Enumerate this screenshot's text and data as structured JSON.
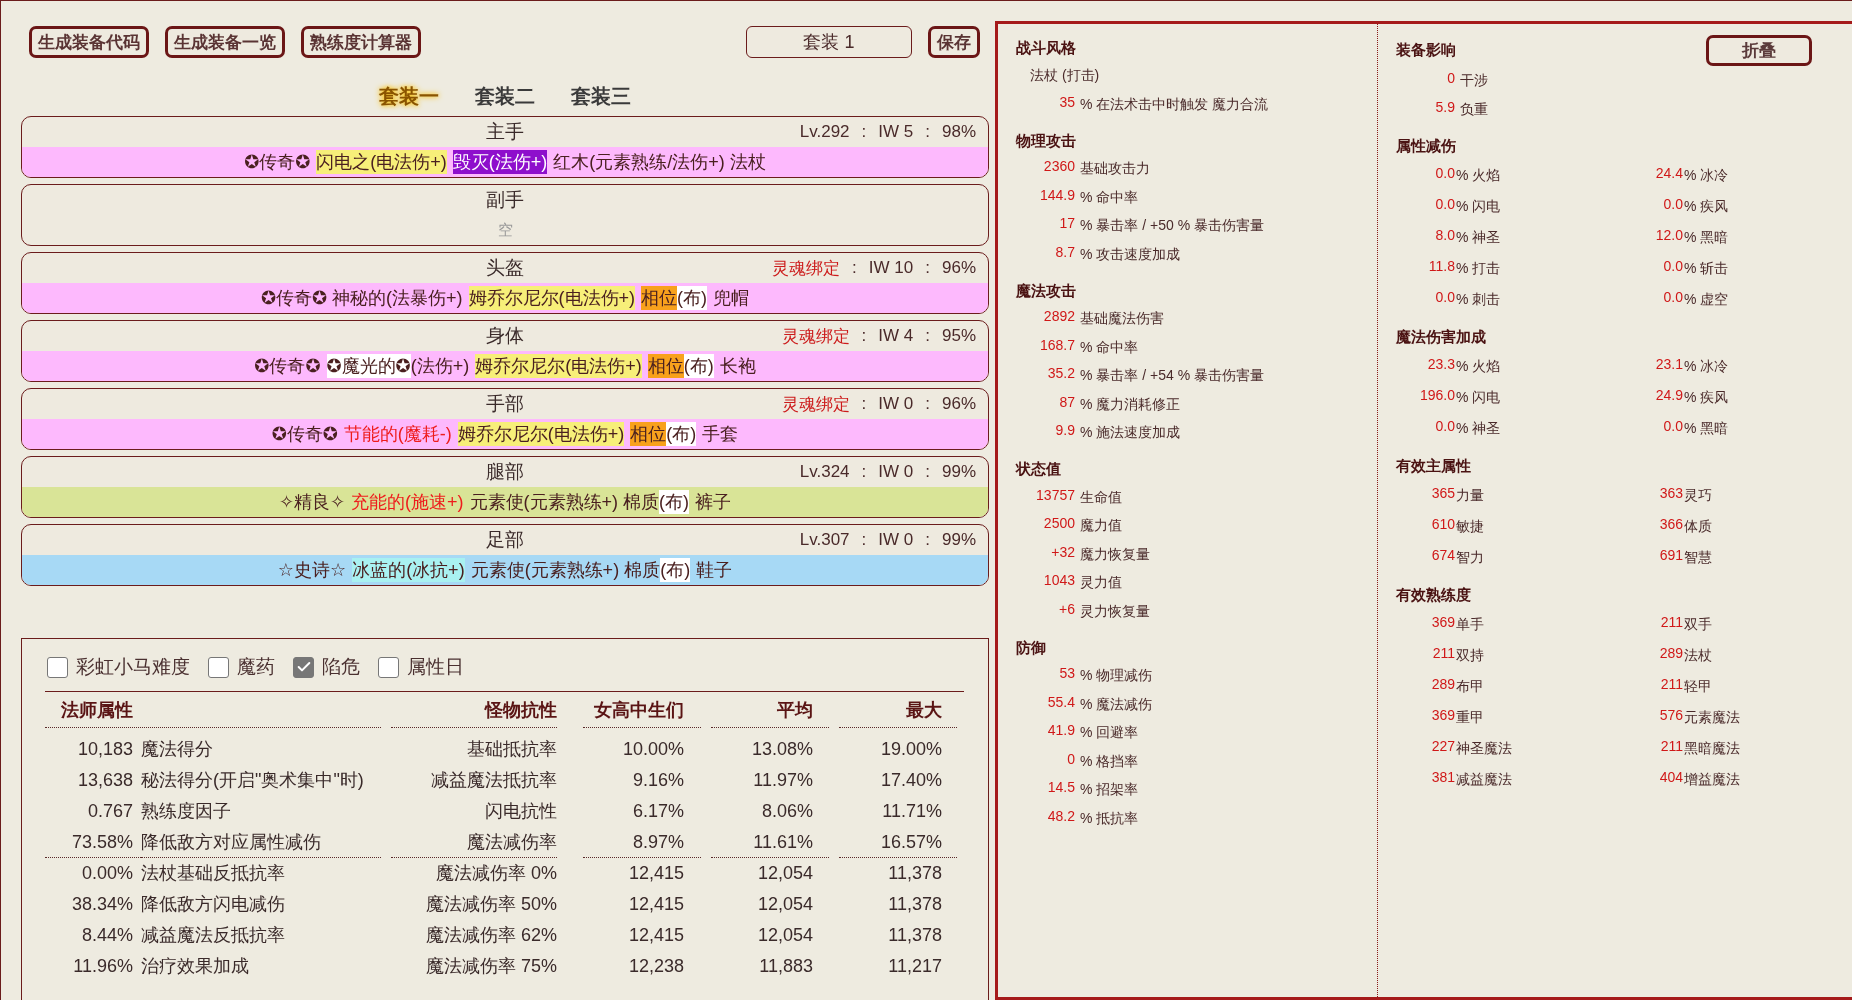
{
  "toolbar": {
    "buttons": [
      "生成装备代码",
      "生成装备一览",
      "熟练度计算器"
    ],
    "set_name": {
      "value": "套装 1"
    },
    "save": "保存"
  },
  "set_tabs": [
    {
      "label": "套装一",
      "selected": true
    },
    {
      "label": "套装二",
      "selected": false
    },
    {
      "label": "套装三",
      "selected": false
    }
  ],
  "slots": [
    {
      "name": "主手",
      "kind": "item",
      "color": "#fdb9fd",
      "meta": [
        {
          "text": "Lv.292",
          "kind": "level"
        },
        {
          "text": ":",
          "kind": "sep"
        },
        {
          "text": "IW 5",
          "kind": "plain"
        },
        {
          "text": ":",
          "kind": "sep"
        },
        {
          "text": "98%",
          "kind": "plain"
        }
      ],
      "words": [
        [
          {
            "text": "✪传奇✪",
            "kind": "plain"
          }
        ],
        [
          {
            "text": "闪电之(电法伤+)",
            "kind": "yellow"
          }
        ],
        [
          {
            "text": "毁灭(法伤+)",
            "kind": "purple"
          }
        ],
        [
          {
            "text": "红木(元素熟练/法伤+) 法杖",
            "kind": "plain"
          }
        ]
      ]
    },
    {
      "name": "副手",
      "kind": "empty",
      "empty_label": "空"
    },
    {
      "name": "头盔",
      "kind": "item",
      "color": "#fdb9fd",
      "meta": [
        {
          "text": "灵魂绑定",
          "kind": "soulbound"
        },
        {
          "text": ":",
          "kind": "sep"
        },
        {
          "text": "IW 10",
          "kind": "plain"
        },
        {
          "text": ":",
          "kind": "sep"
        },
        {
          "text": "96%",
          "kind": "plain"
        }
      ],
      "words": [
        [
          {
            "text": "✪传奇✪ 神秘的(法暴伤+)",
            "kind": "plain"
          }
        ],
        [
          {
            "text": "姆乔尔尼尔(电法伤+)",
            "kind": "yellow"
          }
        ],
        [
          {
            "text": "相位",
            "kind": "orange"
          },
          {
            "text": "(布)",
            "kind": "white"
          }
        ],
        [
          {
            "text": "兜帽",
            "kind": "plain"
          }
        ]
      ]
    },
    {
      "name": "身体",
      "kind": "item",
      "color": "#fdb9fd",
      "meta": [
        {
          "text": "灵魂绑定",
          "kind": "soulbound"
        },
        {
          "text": ":",
          "kind": "sep"
        },
        {
          "text": "IW 4",
          "kind": "plain"
        },
        {
          "text": ":",
          "kind": "sep"
        },
        {
          "text": "95%",
          "kind": "plain"
        }
      ],
      "words": [
        [
          {
            "text": "✪传奇✪",
            "kind": "plain"
          }
        ],
        [
          {
            "text": "✪魔光的✪",
            "kind": "white"
          },
          {
            "text": "(法伤+)",
            "kind": "plain"
          }
        ],
        [
          {
            "text": "姆乔尔尼尔(电法伤+)",
            "kind": "yellow"
          }
        ],
        [
          {
            "text": "相位",
            "kind": "orange"
          },
          {
            "text": "(布)",
            "kind": "white"
          }
        ],
        [
          {
            "text": "长袍",
            "kind": "plain"
          }
        ]
      ]
    },
    {
      "name": "手部",
      "kind": "item",
      "color": "#fdb9fd",
      "meta": [
        {
          "text": "灵魂绑定",
          "kind": "soulbound"
        },
        {
          "text": ":",
          "kind": "sep"
        },
        {
          "text": "IW 0",
          "kind": "plain"
        },
        {
          "text": ":",
          "kind": "sep"
        },
        {
          "text": "96%",
          "kind": "plain"
        }
      ],
      "words": [
        [
          {
            "text": "✪传奇✪",
            "kind": "plain"
          }
        ],
        [
          {
            "text": "节能的(魔耗-)",
            "kind": "red"
          }
        ],
        [
          {
            "text": "姆乔尔尼尔(电法伤+)",
            "kind": "yellow"
          }
        ],
        [
          {
            "text": "相位",
            "kind": "orange"
          },
          {
            "text": "(布)",
            "kind": "white"
          }
        ],
        [
          {
            "text": "手套",
            "kind": "plain"
          }
        ]
      ]
    },
    {
      "name": "腿部",
      "kind": "item",
      "color": "#d9e497",
      "meta": [
        {
          "text": "Lv.324",
          "kind": "level"
        },
        {
          "text": ":",
          "kind": "sep"
        },
        {
          "text": "IW 0",
          "kind": "plain"
        },
        {
          "text": ":",
          "kind": "sep"
        },
        {
          "text": "99%",
          "kind": "plain"
        }
      ],
      "words": [
        [
          {
            "text": "✧精良✧",
            "kind": "plain"
          }
        ],
        [
          {
            "text": "充能的(施速+)",
            "kind": "red"
          }
        ],
        [
          {
            "text": "元素使(元素熟练+) 棉质",
            "kind": "plain"
          },
          {
            "text": "(布)",
            "kind": "white"
          }
        ],
        [
          {
            "text": "裤子",
            "kind": "plain"
          }
        ]
      ]
    },
    {
      "name": "足部",
      "kind": "item",
      "color": "#a7d9f5",
      "meta": [
        {
          "text": "Lv.307",
          "kind": "level"
        },
        {
          "text": ":",
          "kind": "sep"
        },
        {
          "text": "IW 0",
          "kind": "plain"
        },
        {
          "text": ":",
          "kind": "sep"
        },
        {
          "text": "99%",
          "kind": "plain"
        }
      ],
      "words": [
        [
          {
            "text": "☆史诗☆",
            "kind": "plain"
          }
        ],
        [
          {
            "text": "冰蓝的(冰抗+)",
            "kind": "cyan"
          }
        ],
        [
          {
            "text": "元素使(元素熟练+) 棉质",
            "kind": "plain"
          },
          {
            "text": "(布)",
            "kind": "white"
          }
        ],
        [
          {
            "text": "鞋子",
            "kind": "plain"
          }
        ]
      ]
    }
  ],
  "options": [
    {
      "label": "彩虹小马难度",
      "checked": false
    },
    {
      "label": "魔药",
      "checked": false
    },
    {
      "label": "陷危",
      "checked": true
    },
    {
      "label": "属性日",
      "checked": false
    }
  ],
  "stats_table": {
    "columns": [
      "法师属性",
      "怪物抗性",
      "女高中生们",
      "平均",
      "最大"
    ],
    "groups": [
      {
        "rows": [
          {
            "cells": [
              "10,183",
              "魔法得分",
              "基础抵抗率",
              "10.00%",
              "13.08%",
              "19.00%"
            ]
          },
          {
            "cells": [
              "13,638",
              "秘法得分(开启\"奥术集中\"时)",
              "减益魔法抵抗率",
              "9.16%",
              "11.97%",
              "17.40%"
            ]
          },
          {
            "cells": [
              "0.767",
              "熟练度因子",
              "闪电抗性",
              "6.17%",
              "8.06%",
              "11.71%"
            ]
          },
          {
            "cells": [
              "73.58%",
              "降低敌方对应属性减伤",
              "魔法减伤率",
              "8.97%",
              "11.61%",
              "16.57%"
            ]
          }
        ]
      },
      {
        "rows": [
          {
            "cells": [
              "0.00%",
              "法杖基础反抵抗率",
              "魔法减伤率 0%",
              "12,415",
              "12,054",
              "11,378"
            ]
          },
          {
            "cells": [
              "38.34%",
              "降低敌方闪电减伤",
              "魔法减伤率 50%",
              "12,415",
              "12,054",
              "11,378"
            ]
          },
          {
            "cells": [
              "8.44%",
              "减益魔法反抵抗率",
              "魔法减伤率 62%",
              "12,415",
              "12,054",
              "11,378"
            ]
          },
          {
            "cells": [
              "11.96%",
              "治疗效果加成",
              "魔法减伤率 75%",
              "12,238",
              "11,883",
              "11,217"
            ]
          }
        ]
      }
    ]
  },
  "character": {
    "sections": [
      {
        "title": "战斗风格",
        "items": [
          {
            "kind": "note",
            "label": "法杖 (打击)"
          },
          {
            "kind": "stat",
            "value": "35",
            "label": "% 在法术击中时触发 魔力合流"
          }
        ]
      },
      {
        "title": "物理攻击",
        "items": [
          {
            "kind": "stat",
            "value": "2360",
            "label": "基础攻击力"
          },
          {
            "kind": "stat",
            "value": "144.9",
            "label": "% 命中率"
          },
          {
            "kind": "stat",
            "value": "17",
            "label": "% 暴击率 / +50 % 暴击伤害量"
          },
          {
            "kind": "stat",
            "value": "8.7",
            "label": "% 攻击速度加成"
          }
        ]
      },
      {
        "title": "魔法攻击",
        "items": [
          {
            "kind": "stat",
            "value": "2892",
            "label": "基础魔法伤害"
          },
          {
            "kind": "stat",
            "value": "168.7",
            "label": "% 命中率"
          },
          {
            "kind": "stat",
            "value": "35.2",
            "label": "% 暴击率 / +54 % 暴击伤害量"
          },
          {
            "kind": "stat",
            "value": "87",
            "label": "% 魔力消耗修正"
          },
          {
            "kind": "stat",
            "value": "9.9",
            "label": "% 施法速度加成"
          }
        ]
      },
      {
        "title": "状态值",
        "items": [
          {
            "kind": "stat",
            "value": "13757",
            "label": "生命值"
          },
          {
            "kind": "stat",
            "value": "2500",
            "label": "魔力值"
          },
          {
            "kind": "stat",
            "value": "+32",
            "label": "魔力恢复量"
          },
          {
            "kind": "stat",
            "value": "1043",
            "label": "灵力值"
          },
          {
            "kind": "stat",
            "value": "+6",
            "label": "灵力恢复量"
          }
        ]
      },
      {
        "title": "防御",
        "items": [
          {
            "kind": "stat",
            "value": "53",
            "label": "% 物理减伤"
          },
          {
            "kind": "stat",
            "value": "55.4",
            "label": "% 魔法减伤"
          },
          {
            "kind": "stat",
            "value": "41.9",
            "label": "% 回避率"
          },
          {
            "kind": "stat",
            "value": "0",
            "label": "% 格挡率"
          },
          {
            "kind": "stat",
            "value": "14.5",
            "label": "% 招架率"
          },
          {
            "kind": "stat",
            "value": "48.2",
            "label": "% 抵抗率"
          }
        ]
      }
    ]
  },
  "equipment": {
    "collapse_button": "折叠",
    "sections": [
      {
        "title": "装备影响",
        "kind": "single",
        "items": [
          {
            "value": "0",
            "label": "干涉"
          },
          {
            "value": "5.9",
            "label": "负重"
          }
        ]
      },
      {
        "title": "属性减伤",
        "kind": "double",
        "items": [
          {
            "value": "0.0",
            "label": "% 火焰"
          },
          {
            "value": "24.4",
            "label": "% 冰冷"
          },
          {
            "value": "0.0",
            "label": "% 闪电"
          },
          {
            "value": "0.0",
            "label": "% 疾风"
          },
          {
            "value": "8.0",
            "label": "% 神圣"
          },
          {
            "value": "12.0",
            "label": "% 黑暗"
          },
          {
            "value": "11.8",
            "label": "% 打击"
          },
          {
            "value": "0.0",
            "label": "% 斩击"
          },
          {
            "value": "0.0",
            "label": "% 刺击"
          },
          {
            "value": "0.0",
            "label": "% 虚空"
          }
        ]
      },
      {
        "title": "魔法伤害加成",
        "kind": "double",
        "items": [
          {
            "value": "23.3",
            "label": "% 火焰"
          },
          {
            "value": "23.1",
            "label": "% 冰冷"
          },
          {
            "value": "196.0",
            "label": "% 闪电"
          },
          {
            "value": "24.9",
            "label": "% 疾风"
          },
          {
            "value": "0.0",
            "label": "% 神圣"
          },
          {
            "value": "0.0",
            "label": "% 黑暗"
          }
        ]
      },
      {
        "title": "有效主属性",
        "kind": "double",
        "items": [
          {
            "value": "365",
            "label": "力量"
          },
          {
            "value": "363",
            "label": "灵巧"
          },
          {
            "value": "610",
            "label": "敏捷"
          },
          {
            "value": "366",
            "label": "体质"
          },
          {
            "value": "674",
            "label": "智力"
          },
          {
            "value": "691",
            "label": "智慧"
          }
        ]
      },
      {
        "title": "有效熟练度",
        "kind": "double",
        "items": [
          {
            "value": "369",
            "label": "单手"
          },
          {
            "value": "211",
            "label": "双手"
          },
          {
            "value": "211",
            "label": "双持"
          },
          {
            "value": "289",
            "label": "法杖"
          },
          {
            "value": "289",
            "label": "布甲"
          },
          {
            "value": "211",
            "label": "轻甲"
          },
          {
            "value": "369",
            "label": "重甲"
          },
          {
            "value": "576",
            "label": "元素魔法"
          },
          {
            "value": "227",
            "label": "神圣魔法"
          },
          {
            "value": "211",
            "label": "黑暗魔法"
          },
          {
            "value": "381",
            "label": "减益魔法"
          },
          {
            "value": "404",
            "label": "增益魔法"
          }
        ]
      }
    ]
  }
}
